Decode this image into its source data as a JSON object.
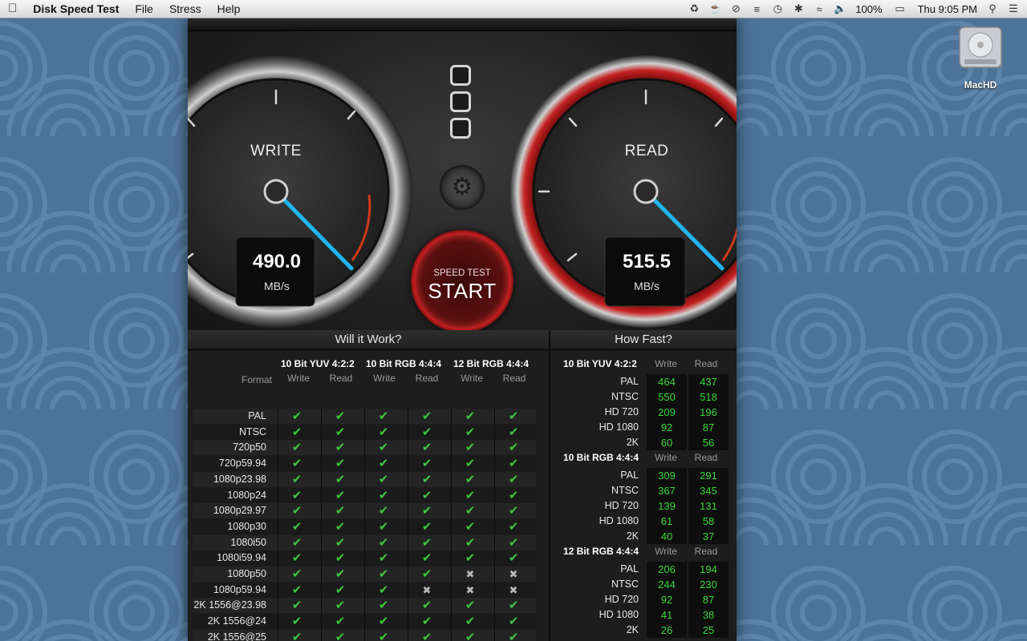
{
  "menubar": {
    "app": "Disk Speed Test",
    "items": [
      "File",
      "Stress",
      "Help"
    ],
    "battery": "100%",
    "clock": "Thu 9:05 PM"
  },
  "desktop": {
    "drive_label": "MacHD"
  },
  "gauges": {
    "write": {
      "title": "WRITE",
      "value": "490.0",
      "unit": "MB/s"
    },
    "read": {
      "title": "READ",
      "value": "515.5",
      "unit": "MB/s"
    }
  },
  "start_button": {
    "line1": "SPEED TEST",
    "line2": "START"
  },
  "will_it_work": {
    "title": "Will it Work?",
    "format_label": "Format",
    "groups": [
      "10 Bit YUV 4:2:2",
      "10 Bit RGB 4:4:4",
      "12 Bit RGB 4:4:4"
    ],
    "subcols": [
      "Write",
      "Read",
      "Write",
      "Read",
      "Write",
      "Read"
    ],
    "rows": [
      {
        "name": "PAL",
        "cells": [
          1,
          1,
          1,
          1,
          1,
          1
        ]
      },
      {
        "name": "NTSC",
        "cells": [
          1,
          1,
          1,
          1,
          1,
          1
        ]
      },
      {
        "name": "720p50",
        "cells": [
          1,
          1,
          1,
          1,
          1,
          1
        ]
      },
      {
        "name": "720p59.94",
        "cells": [
          1,
          1,
          1,
          1,
          1,
          1
        ]
      },
      {
        "name": "1080p23.98",
        "cells": [
          1,
          1,
          1,
          1,
          1,
          1
        ]
      },
      {
        "name": "1080p24",
        "cells": [
          1,
          1,
          1,
          1,
          1,
          1
        ]
      },
      {
        "name": "1080p29.97",
        "cells": [
          1,
          1,
          1,
          1,
          1,
          1
        ]
      },
      {
        "name": "1080p30",
        "cells": [
          1,
          1,
          1,
          1,
          1,
          1
        ]
      },
      {
        "name": "1080i50",
        "cells": [
          1,
          1,
          1,
          1,
          1,
          1
        ]
      },
      {
        "name": "1080i59.94",
        "cells": [
          1,
          1,
          1,
          1,
          1,
          1
        ]
      },
      {
        "name": "1080p50",
        "cells": [
          1,
          1,
          1,
          1,
          0,
          0
        ]
      },
      {
        "name": "1080p59.94",
        "cells": [
          1,
          1,
          1,
          0,
          0,
          0
        ]
      },
      {
        "name": "2K 1556@23.98",
        "cells": [
          1,
          1,
          1,
          1,
          1,
          1
        ]
      },
      {
        "name": "2K 1556@24",
        "cells": [
          1,
          1,
          1,
          1,
          1,
          1
        ]
      },
      {
        "name": "2K 1556@25",
        "cells": [
          1,
          1,
          1,
          1,
          1,
          1
        ]
      }
    ]
  },
  "how_fast": {
    "title": "How Fast?",
    "write_label": "Write",
    "read_label": "Read",
    "groups": [
      {
        "title": "10 Bit YUV 4:2:2",
        "rows": [
          {
            "name": "PAL",
            "write": "464",
            "read": "437"
          },
          {
            "name": "NTSC",
            "write": "550",
            "read": "518"
          },
          {
            "name": "HD 720",
            "write": "209",
            "read": "196"
          },
          {
            "name": "HD 1080",
            "write": "92",
            "read": "87"
          },
          {
            "name": "2K",
            "write": "60",
            "read": "56"
          }
        ]
      },
      {
        "title": "10 Bit RGB 4:4:4",
        "rows": [
          {
            "name": "PAL",
            "write": "309",
            "read": "291"
          },
          {
            "name": "NTSC",
            "write": "367",
            "read": "345"
          },
          {
            "name": "HD 720",
            "write": "139",
            "read": "131"
          },
          {
            "name": "HD 1080",
            "write": "61",
            "read": "58"
          },
          {
            "name": "2K",
            "write": "40",
            "read": "37"
          }
        ]
      },
      {
        "title": "12 Bit RGB 4:4:4",
        "rows": [
          {
            "name": "PAL",
            "write": "206",
            "read": "194"
          },
          {
            "name": "NTSC",
            "write": "244",
            "read": "230"
          },
          {
            "name": "HD 720",
            "write": "92",
            "read": "87"
          },
          {
            "name": "HD 1080",
            "write": "41",
            "read": "38"
          },
          {
            "name": "2K",
            "write": "26",
            "read": "25"
          }
        ]
      }
    ]
  },
  "colors": {
    "check": "#3ec53e",
    "value_green": "#39d639",
    "needle": "#1fb6f0",
    "redline": "#d03a1a",
    "read_ring": "#b01818"
  }
}
